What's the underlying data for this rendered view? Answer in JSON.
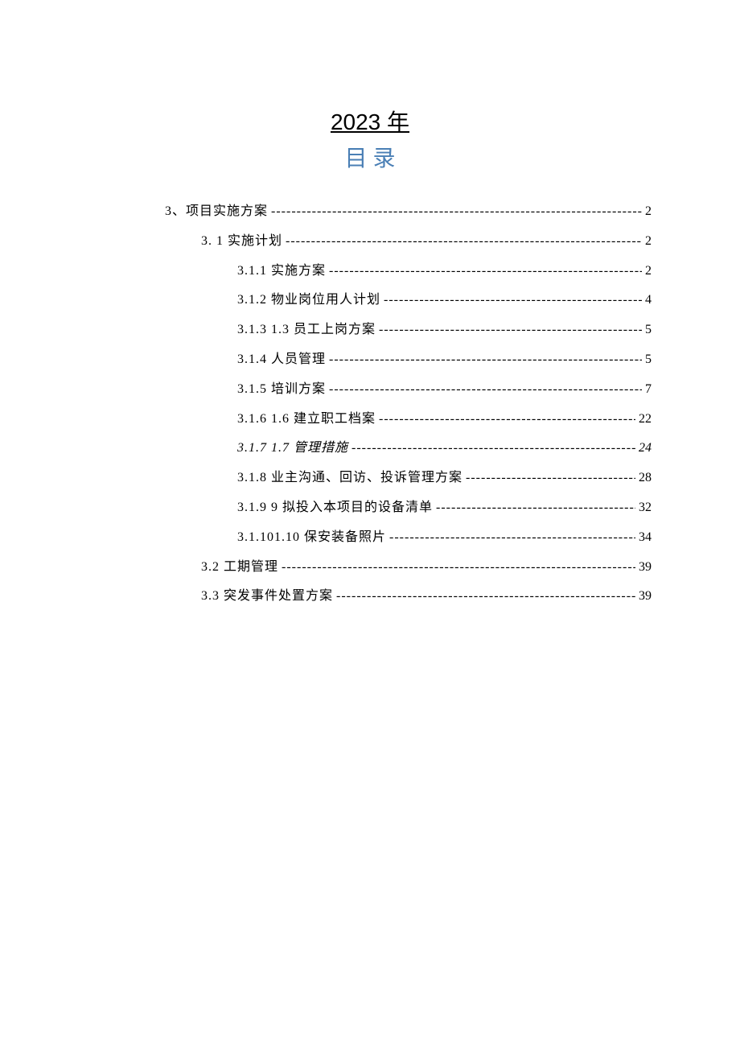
{
  "header": {
    "year_title": "2023 年",
    "toc_title": "目 录"
  },
  "toc": {
    "items": [
      {
        "level": 1,
        "label": "3、项目实施方案",
        "page": "2",
        "italic": false
      },
      {
        "level": 2,
        "label": "3.  1 实施计划",
        "page": "2",
        "italic": false
      },
      {
        "level": 3,
        "label": "3.1.1   实施方案",
        "page": "2",
        "italic": false
      },
      {
        "level": 3,
        "label": "3.1.2   物业岗位用人计划",
        "page": "4",
        "italic": false
      },
      {
        "level": 3,
        "label": "3.1.3  1.3 员工上岗方案",
        "page": "5",
        "italic": false
      },
      {
        "level": 3,
        "label": "3.1.4   人员管理",
        "page": "5",
        "italic": false
      },
      {
        "level": 3,
        "label": "3.1.5   培训方案",
        "page": "7",
        "italic": false
      },
      {
        "level": 3,
        "label": "3.1.6  1.6 建立职工档案",
        "page": "22",
        "italic": false
      },
      {
        "level": 3,
        "label": "3.1.7 1.7 管理措施",
        "page": "24",
        "italic": true
      },
      {
        "level": 3,
        "label": "3.1.8   业主沟通、回访、投诉管理方案",
        "page": "28",
        "italic": false
      },
      {
        "level": 3,
        "label": "3.1.9  9 拟投入本项目的设备清单",
        "page": "32",
        "italic": false
      },
      {
        "level": 3,
        "label": "3.1.101.10 保安装备照片",
        "page": "34",
        "italic": false
      },
      {
        "level": 2,
        "label": "3.2   工期管理",
        "page": "39",
        "italic": false
      },
      {
        "level": 2,
        "label": "3.3   突发事件处置方案",
        "page": "39",
        "italic": false
      }
    ]
  }
}
